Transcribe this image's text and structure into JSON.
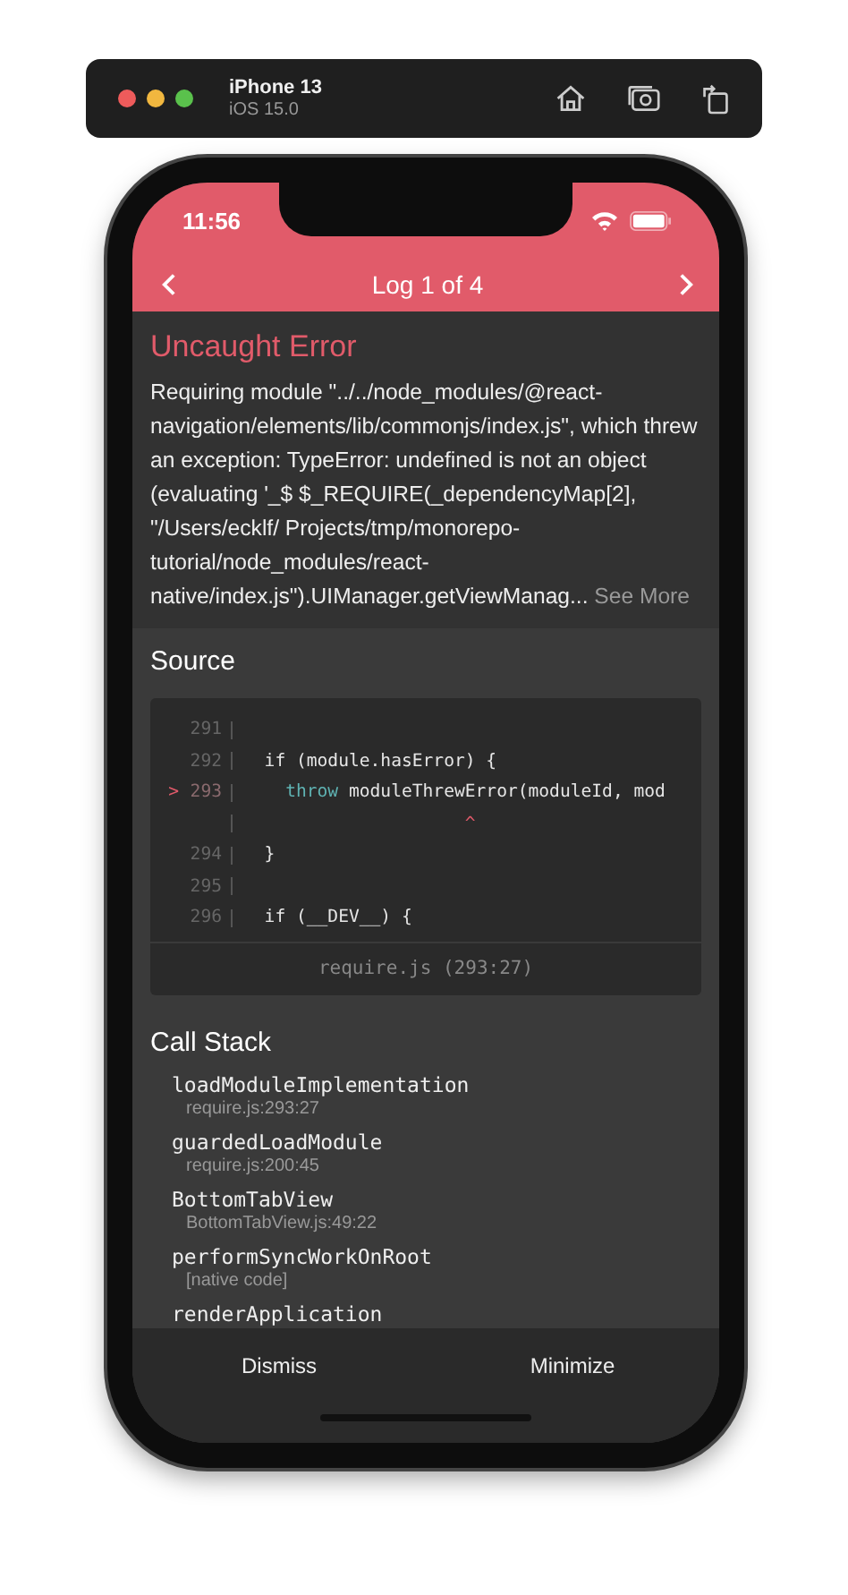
{
  "simulator": {
    "device": "iPhone 13",
    "os": "iOS 15.0"
  },
  "status_bar": {
    "time": "11:56"
  },
  "nav": {
    "title": "Log 1 of 4"
  },
  "error": {
    "title": "Uncaught Error",
    "message": "Requiring module \"../../node_modules/@react-navigation/elements/lib/commonjs/index.js\", which threw an exception: TypeError: undefined is not an object (evaluating '_$ $_REQUIRE(_dependencyMap[2], \"/Users/ecklf/ Projects/tmp/monorepo-tutorial/node_modules/react-native/index.js\").UIManager.getViewManag...",
    "more": "See More"
  },
  "source": {
    "title": "Source",
    "lines": [
      {
        "kind": "code",
        "number": "291"
      },
      {
        "kind": "code",
        "number": "292",
        "tokens": [
          {
            "text": "  if (module.hasError) {",
            "kind": "plain"
          }
        ]
      },
      {
        "kind": "current",
        "marker": ">",
        "number": "293",
        "tokens": [
          {
            "text": "    throw",
            "kind": "keyword"
          },
          {
            "text": " moduleThrewError(moduleId, mod",
            "kind": "plain"
          }
        ]
      },
      {
        "kind": "caret",
        "tokens": [
          {
            "text": "                     ^",
            "kind": "caret"
          }
        ]
      },
      {
        "kind": "code",
        "number": "294",
        "tokens": [
          {
            "text": "  }",
            "kind": "plain"
          }
        ]
      },
      {
        "kind": "code",
        "number": "295"
      },
      {
        "kind": "code",
        "number": "296",
        "tokens": [
          {
            "text": "  if (__DEV__) {",
            "kind": "plain"
          }
        ]
      }
    ],
    "file": "require.js (293:27)"
  },
  "call_stack": {
    "title": "Call Stack",
    "frames": [
      {
        "name": "loadModuleImplementation",
        "location": "require.js:293:27"
      },
      {
        "name": "guardedLoadModule",
        "location": "require.js:200:45"
      },
      {
        "name": "BottomTabView",
        "location": "BottomTabView.js:49:22"
      },
      {
        "name": "performSyncWorkOnRoot",
        "location": "[native code]"
      },
      {
        "name": "renderApplication"
      }
    ]
  },
  "buttons": [
    "Dismiss",
    "Minimize"
  ]
}
